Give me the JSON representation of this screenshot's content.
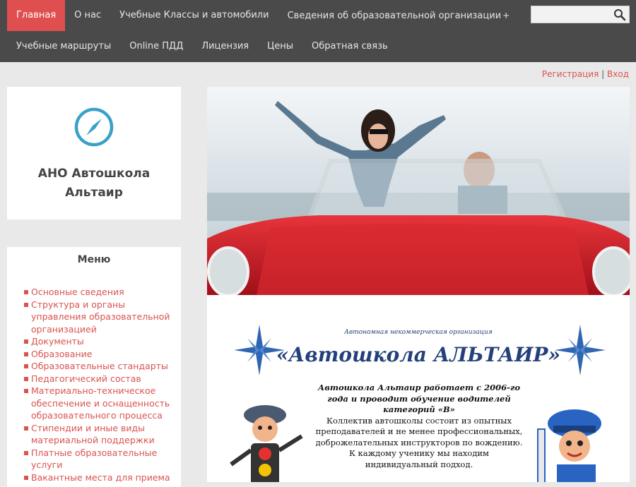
{
  "nav": {
    "row1": [
      {
        "label": "Главная",
        "active": true
      },
      {
        "label": "О нас"
      },
      {
        "label": "Учебные Классы и автомобили"
      },
      {
        "label": "Сведения об образовательной организации",
        "has_sub": true
      }
    ],
    "sub_marker": "+",
    "row2": [
      {
        "label": "Учебные маршруты"
      },
      {
        "label": "Online ПДД"
      },
      {
        "label": "Лицензия"
      },
      {
        "label": "Цены"
      },
      {
        "label": "Обратная связь"
      }
    ],
    "search_placeholder": ""
  },
  "auth": {
    "register": "Регистрация",
    "separator": "|",
    "login": "Вход"
  },
  "brand": {
    "name": "АНО Автошкола Альтаир",
    "accent": "#3aa0c8"
  },
  "menu": {
    "title": "Меню",
    "items": [
      "Основные сведения",
      "Структура и органы управления образовательной организацией",
      "Документы",
      "Образование",
      "Образовательные стандарты",
      "Педагогический состав",
      "Материально-техническое обеспечение и оснащенность образовательного процесса",
      "Стипендии и иные виды материальной поддержки",
      "Платные образовательные услуги",
      "Вакантные места для приема"
    ]
  },
  "promo": {
    "subtitle": "Автономная некоммерческая организация",
    "title": "«Автошкола АЛЬТАИР»",
    "lead": "Автошкола Альтаир работает с 2006-го года и проводит обучение водителей категорий «В»",
    "body": "Коллектив автошколы состоит из опытных преподавателей и не менее профессиональных, доброжелательных инструкторов по вождению. К каждому ученику мы находим индивидуальный подход."
  },
  "colors": {
    "nav_bg": "#4a4a4a",
    "active": "#e04f4f",
    "link": "#d9534f",
    "promo_blue": "#24407a"
  }
}
